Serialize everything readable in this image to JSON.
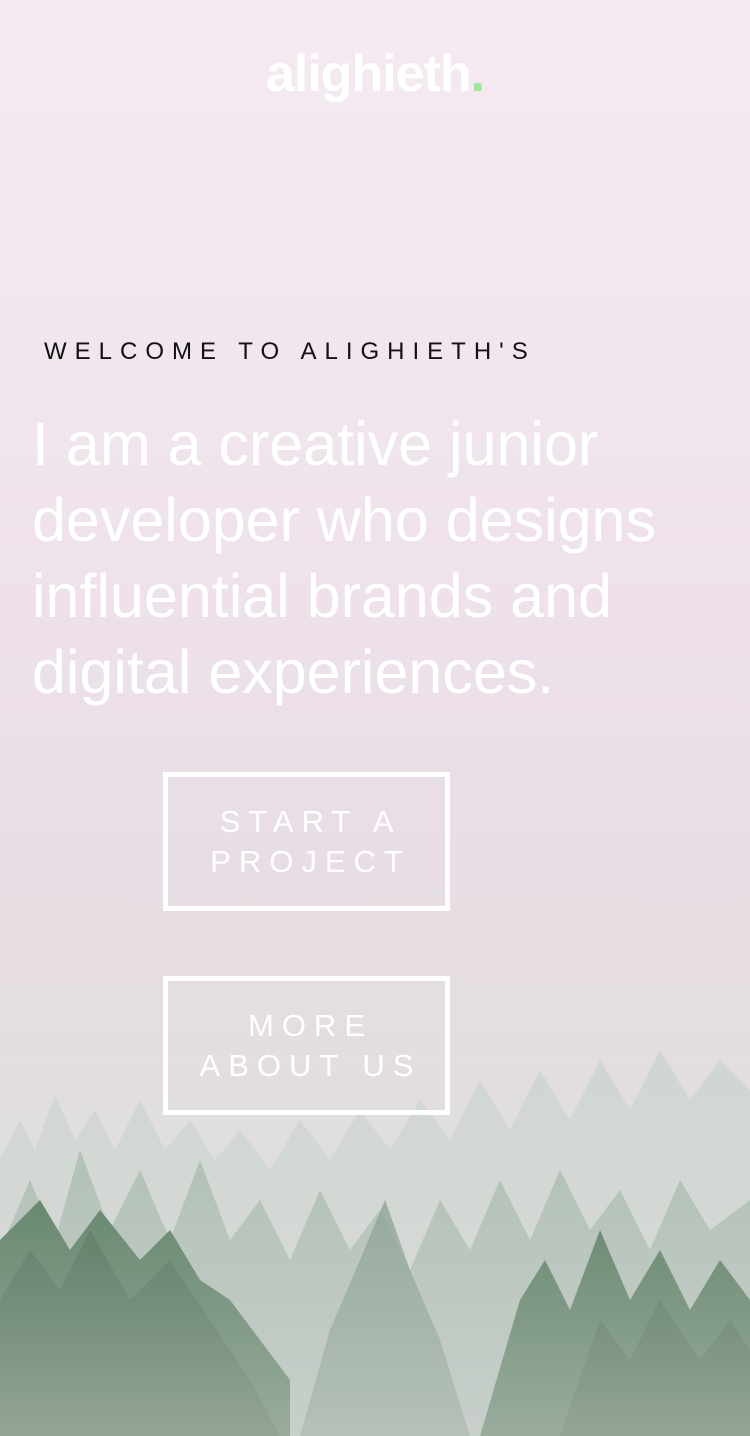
{
  "header": {
    "logo_text": "alighieth",
    "logo_dot": ".",
    "accent_color": "#9be79b"
  },
  "hero": {
    "eyebrow": "WELCOME TO ALIGHIETH'S",
    "headline": "I am a creative junior developer who designs influential brands and digital experiences.",
    "buttons": {
      "start_project": "START A PROJECT",
      "more_about": "MORE ABOUT US"
    }
  },
  "background": {
    "scene": "misty-pine-forest",
    "colors": {
      "sky_top": "#f4eaf1",
      "sky_bottom": "#cfd6d0",
      "tree_dark": "#2f5a3a",
      "tree_light": "#6f8f79"
    }
  }
}
